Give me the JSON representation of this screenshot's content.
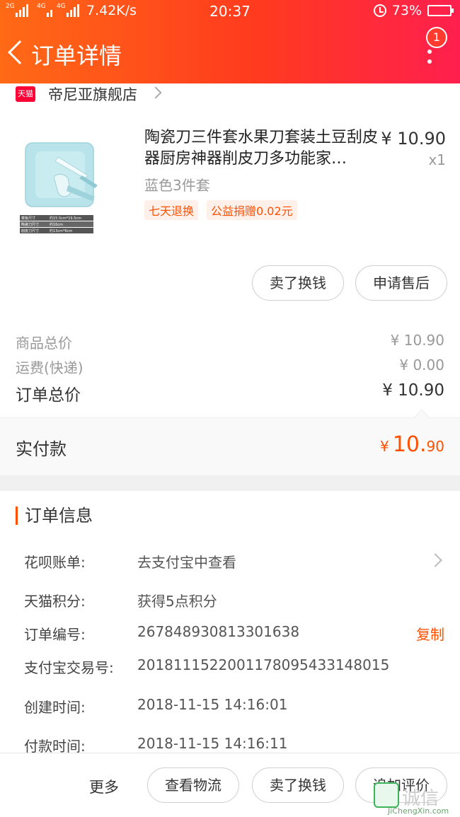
{
  "status_bar": {
    "network_1": "2G",
    "network_2": "4G",
    "network_3": "4G",
    "speed": "7.42K/s",
    "time": "20:37",
    "battery": "73%",
    "battery_level": 0.73
  },
  "header": {
    "title": "订单详情",
    "badge_count": "1"
  },
  "shop": {
    "icon_text": "天猫",
    "name": "帝尼亚旗舰店"
  },
  "product": {
    "title": "陶瓷刀三件套水果刀套装土豆刮皮器厨房神器削皮刀多功能家…",
    "price": "¥ 10.90",
    "qty": "x1",
    "sku": "蓝色3件套",
    "tags": [
      "七天退换",
      "公益捐赠0.02元"
    ],
    "spec_lines": [
      [
        "菜板尺寸",
        "约15.5cm*19.5cm"
      ],
      [
        "陶瓷刀尺寸",
        "约16cm"
      ],
      [
        "削皮刀尺寸",
        "约13cm*6cm"
      ]
    ]
  },
  "item_actions": {
    "sell": "卖了换钱",
    "after_sale": "申请售后"
  },
  "summary": {
    "goods_label": "商品总价",
    "goods_value": "¥ 10.90",
    "shipping_label": "运费(快递)",
    "shipping_value": "¥ 0.00",
    "total_label": "订单总价",
    "total_value": "¥ 10.90",
    "paid_label": "实付款",
    "paid_currency": "¥",
    "paid_int": "10.",
    "paid_dec": "90"
  },
  "order_info": {
    "section_title": "订单信息",
    "rows": [
      {
        "label": "花呗账单:",
        "value": "去支付宝中查看"
      },
      {
        "label": "天猫积分:",
        "value": "获得5点积分"
      },
      {
        "label": "订单编号:",
        "value": "267848930813301638"
      },
      {
        "label": "支付宝交易号:",
        "value": "2018111522001178095433148015"
      },
      {
        "label": "创建时间:",
        "value": "2018-11-15 14:16:01"
      },
      {
        "label": "付款时间:",
        "value": "2018-11-15 14:16:11"
      }
    ],
    "copy_label": "复制"
  },
  "bottom_bar": {
    "more": "更多",
    "logistics": "查看物流",
    "sell": "卖了换钱",
    "review": "追加评价"
  },
  "watermark": {
    "text": "诚信",
    "url": "JiChengXin.com"
  },
  "colors": {
    "accent": "#ff5000",
    "header_start": "#ff6a16",
    "header_end": "#ff1f4e",
    "tmall_red": "#ff0036"
  }
}
